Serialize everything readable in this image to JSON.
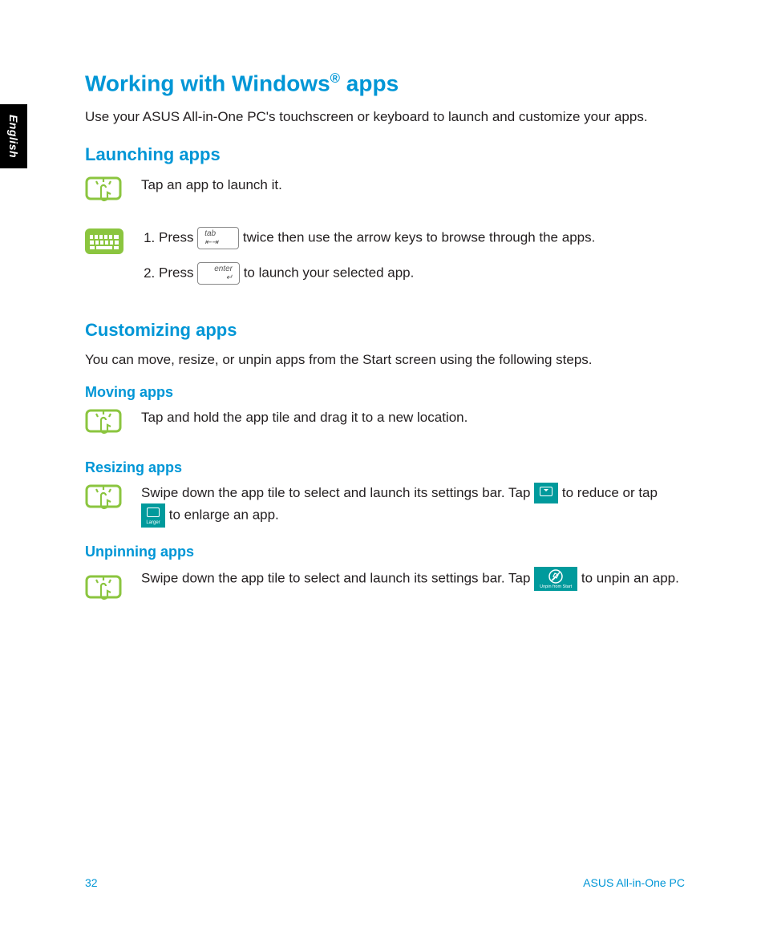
{
  "sideTab": "English",
  "title_pre": "Working with Windows",
  "title_post": " apps",
  "intro": "Use your ASUS All-in-One PC's touchscreen or keyboard to launch and customize your apps.",
  "launching": {
    "heading": "Launching apps",
    "touch_text": "Tap an app to launch it.",
    "step1_a": "Press ",
    "step1_key": "tab",
    "step1_b": " twice then use the arrow keys to browse through the apps.",
    "step2_a": "Press ",
    "step2_key": "enter",
    "step2_b": " to launch your selected app."
  },
  "customizing": {
    "heading": "Customizing apps",
    "intro": "You can move, resize, or unpin apps from the Start screen using the following steps.",
    "moving_h": "Moving apps",
    "moving_text": "Tap and hold the app tile and drag it to a new location.",
    "resizing_h": "Resizing apps",
    "resizing_a": "Swipe down the app tile to select and launch its settings bar. Tap ",
    "resizing_b": " to reduce or tap ",
    "resizing_c": " to enlarge an app.",
    "larger_label": "Larger",
    "unpinning_h": "Unpinning apps",
    "unpinning_a": "Swipe down the app tile to select and launch its settings bar. Tap ",
    "unpinning_b": " to unpin an app.",
    "unpin_label": "Unpin from Start"
  },
  "footer": {
    "page": "32",
    "product": "ASUS All-in-One PC"
  }
}
